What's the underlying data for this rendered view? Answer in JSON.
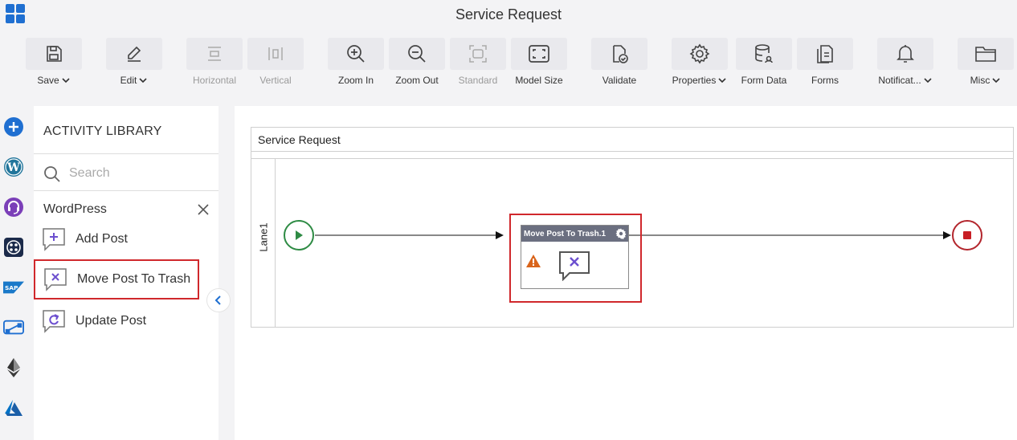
{
  "title": "Service Request",
  "toolbar": {
    "save": "Save",
    "edit": "Edit",
    "horizontal": "Horizontal",
    "vertical": "Vertical",
    "zoom_in": "Zoom In",
    "zoom_out": "Zoom Out",
    "standard": "Standard",
    "model_size": "Model Size",
    "validate": "Validate",
    "properties": "Properties",
    "form_data": "Form Data",
    "forms": "Forms",
    "notifications": "Notificat...",
    "misc": "Misc"
  },
  "rail": {
    "icons": [
      "add-icon",
      "wordpress-icon",
      "support-agent-icon",
      "circle-grid-icon",
      "sap-icon",
      "flow-icon",
      "ethereum-icon",
      "azure-icon"
    ],
    "sap_label": "SAP"
  },
  "library": {
    "title": "ACTIVITY LIBRARY",
    "search_placeholder": "Search",
    "category": "WordPress",
    "activities": [
      {
        "label": "Add Post",
        "icon": "add-post-icon"
      },
      {
        "label": "Move Post To Trash",
        "icon": "move-to-trash-icon"
      },
      {
        "label": "Update Post",
        "icon": "update-post-icon"
      }
    ]
  },
  "canvas": {
    "pool_title": "Service Request",
    "lane_label": "Lane1",
    "task_title": "Move Post To Trash.1"
  },
  "colors": {
    "accent_purple": "#6c4fcf",
    "highlight_red": "#d0282c",
    "start_green": "#2e8b44",
    "end_red": "#b3262d",
    "warning_orange": "#d9641b",
    "task_header": "#6b6f80"
  }
}
